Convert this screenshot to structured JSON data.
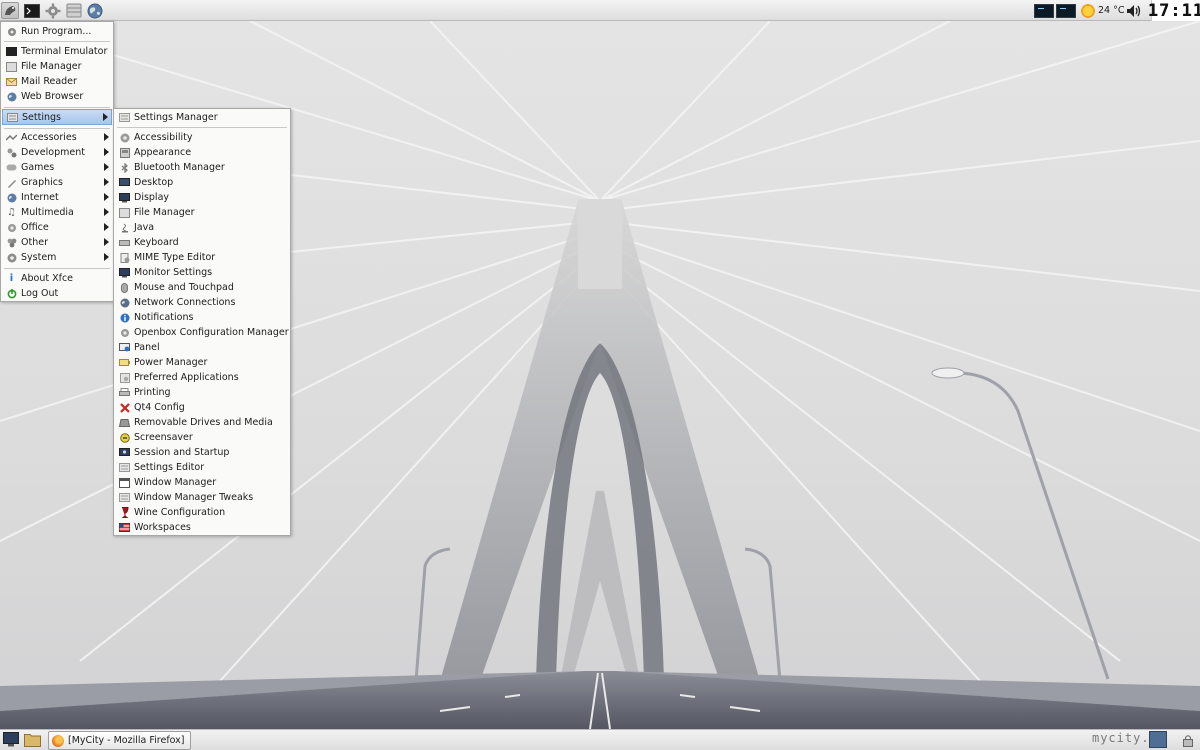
{
  "top_panel": {
    "weather_temp": "24 °C",
    "clock": "17:11",
    "icons": [
      "xfce-menu-icon",
      "terminal-icon",
      "settings-icon",
      "file-manager-icon",
      "web-browser-icon"
    ]
  },
  "app_menu": {
    "items": [
      {
        "label": "Run Program...",
        "icon": "run-icon"
      },
      {
        "label": "Terminal Emulator",
        "icon": "terminal-icon"
      },
      {
        "label": "File Manager",
        "icon": "file-manager-icon"
      },
      {
        "label": "Mail Reader",
        "icon": "mail-icon"
      },
      {
        "label": "Web Browser",
        "icon": "globe-icon"
      },
      {
        "label": "Settings",
        "icon": "settings-icon",
        "submenu": true,
        "active": true
      },
      {
        "label": "Accessories",
        "icon": "accessories-icon",
        "submenu": true
      },
      {
        "label": "Development",
        "icon": "development-icon",
        "submenu": true
      },
      {
        "label": "Games",
        "icon": "gamepad-icon",
        "submenu": true
      },
      {
        "label": "Graphics",
        "icon": "graphics-icon",
        "submenu": true
      },
      {
        "label": "Internet",
        "icon": "globe-icon",
        "submenu": true
      },
      {
        "label": "Multimedia",
        "icon": "music-icon",
        "submenu": true
      },
      {
        "label": "Office",
        "icon": "office-icon",
        "submenu": true
      },
      {
        "label": "Other",
        "icon": "other-icon",
        "submenu": true
      },
      {
        "label": "System",
        "icon": "system-icon",
        "submenu": true
      },
      {
        "label": "About Xfce",
        "icon": "info-icon"
      },
      {
        "label": "Log Out",
        "icon": "logout-icon"
      }
    ]
  },
  "settings_menu": {
    "items": [
      {
        "label": "Settings Manager",
        "icon": "settings-manager-icon"
      },
      {
        "label": "Accessibility",
        "icon": "accessibility-icon"
      },
      {
        "label": "Appearance",
        "icon": "appearance-icon"
      },
      {
        "label": "Bluetooth Manager",
        "icon": "bluetooth-icon"
      },
      {
        "label": "Desktop",
        "icon": "desktop-icon"
      },
      {
        "label": "Display",
        "icon": "display-icon"
      },
      {
        "label": "File Manager",
        "icon": "file-manager-icon"
      },
      {
        "label": "Java",
        "icon": "java-icon"
      },
      {
        "label": "Keyboard",
        "icon": "keyboard-icon"
      },
      {
        "label": "MIME Type Editor",
        "icon": "mime-icon"
      },
      {
        "label": "Monitor Settings",
        "icon": "monitor-icon"
      },
      {
        "label": "Mouse and Touchpad",
        "icon": "mouse-icon"
      },
      {
        "label": "Network Connections",
        "icon": "network-icon"
      },
      {
        "label": "Notifications",
        "icon": "notifications-icon"
      },
      {
        "label": "Openbox Configuration Manager",
        "icon": "openbox-icon"
      },
      {
        "label": "Panel",
        "icon": "panel-icon"
      },
      {
        "label": "Power Manager",
        "icon": "power-icon"
      },
      {
        "label": "Preferred Applications",
        "icon": "preferred-apps-icon"
      },
      {
        "label": "Printing",
        "icon": "printer-icon"
      },
      {
        "label": "Qt4 Config",
        "icon": "qt-icon"
      },
      {
        "label": "Removable Drives and Media",
        "icon": "drive-icon"
      },
      {
        "label": "Screensaver",
        "icon": "screensaver-icon"
      },
      {
        "label": "Session and Startup",
        "icon": "session-icon"
      },
      {
        "label": "Settings Editor",
        "icon": "settings-editor-icon"
      },
      {
        "label": "Window Manager",
        "icon": "window-manager-icon"
      },
      {
        "label": "Window Manager Tweaks",
        "icon": "wm-tweaks-icon"
      },
      {
        "label": "Wine Configuration",
        "icon": "wine-icon"
      },
      {
        "label": "Workspaces",
        "icon": "workspaces-icon"
      }
    ]
  },
  "taskbar": {
    "window_title": "[MyCity - Mozilla Firefox]"
  },
  "watermark": "mycity.rs",
  "colors": {
    "menu_bg": "#fafaf8",
    "highlight": "#aac5ea",
    "panel_bg": "#e8e8e8",
    "wallpaper_sky": "#e2e2e2",
    "road": "#6b6e78"
  }
}
